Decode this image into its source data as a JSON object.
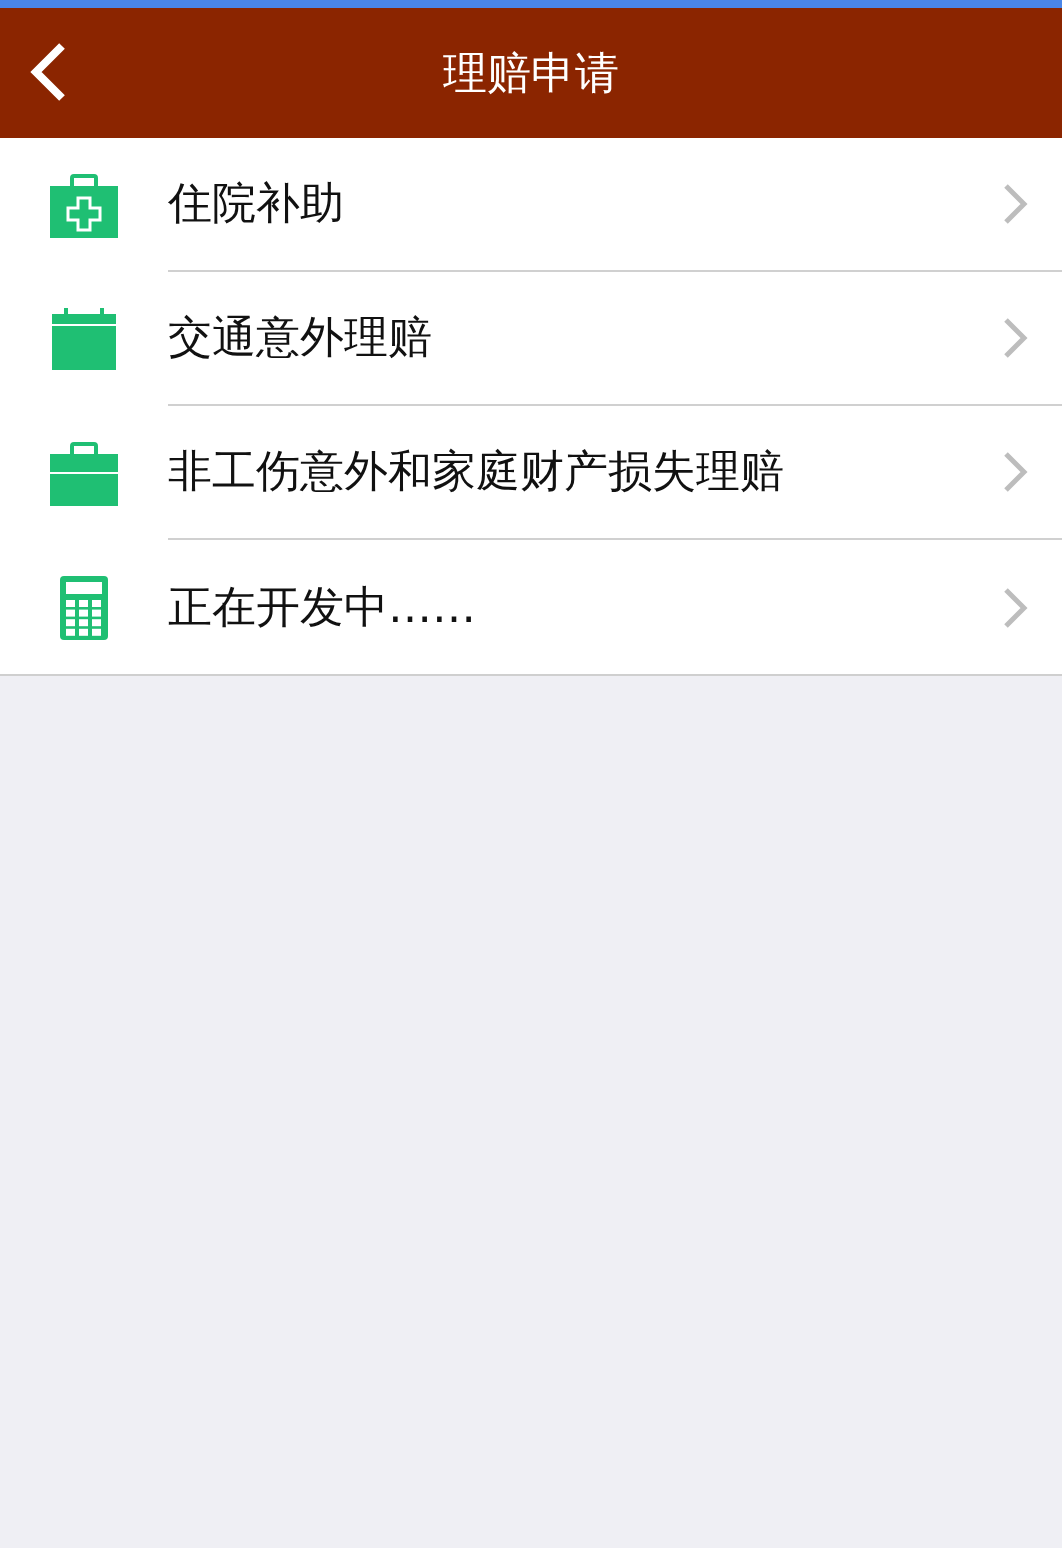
{
  "header": {
    "title": "理赔申请"
  },
  "items": [
    {
      "kind": "medkit",
      "label": "住院补助"
    },
    {
      "kind": "calendar",
      "label": "交通意外理赔"
    },
    {
      "kind": "briefcase",
      "label": "非工伤意外和家庭财产损失理赔"
    },
    {
      "kind": "calculator",
      "label": "正在开发中……"
    }
  ]
}
